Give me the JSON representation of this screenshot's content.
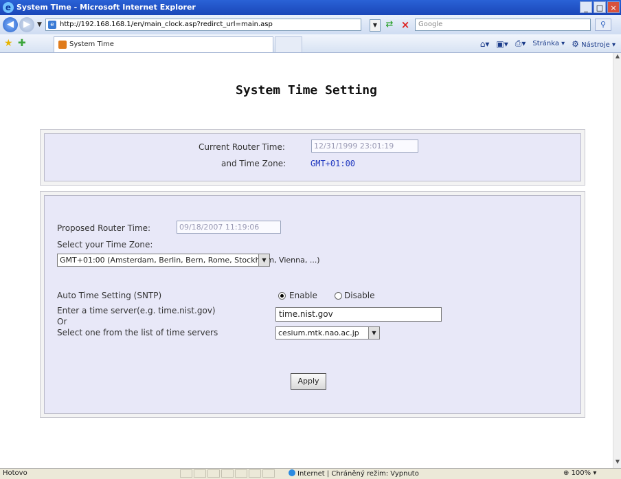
{
  "window": {
    "title": "System Time - Microsoft Internet Explorer",
    "buttons": {
      "minimize": "_",
      "maximize": "□",
      "close": "×"
    }
  },
  "browser": {
    "url": "http://192.168.168.1/en/main_clock.asp?redirct_url=main.asp",
    "search_placeholder": "Google",
    "tab_label": "System Time",
    "commands": {
      "page": "Stránka",
      "tools": "Nástroje"
    }
  },
  "page": {
    "title": "System Time Setting",
    "current": {
      "router_time_label": "Current Router Time:",
      "router_time_value": "12/31/1999 23:01:19",
      "time_zone_label": "and Time Zone:",
      "time_zone_value": "GMT+01:00"
    },
    "settings": {
      "proposed_label": "Proposed Router Time:",
      "proposed_value": "09/18/2007 11:19:06",
      "select_zone_label": "Select your Time Zone:",
      "zone_selected": "GMT+01:00 (Amsterdam, Berlin, Bern, Rome, Stockholm, Vienna, ...)",
      "sntp_label": "Auto Time Setting (SNTP)",
      "enable_label": "Enable",
      "disable_label": "Disable",
      "sntp_enabled": true,
      "server_label": "Enter a time server(e.g. time.nist.gov)",
      "or_label": "Or",
      "list_label": "Select one from the list of time servers",
      "server_value": "time.nist.gov",
      "server_list_selected": "cesium.mtk.nao.ac.jp",
      "apply_label": "Apply"
    }
  },
  "status": {
    "left": "Hotovo",
    "zone": "Internet | Chráněný režim: Vypnuto",
    "zoom": "100%"
  }
}
